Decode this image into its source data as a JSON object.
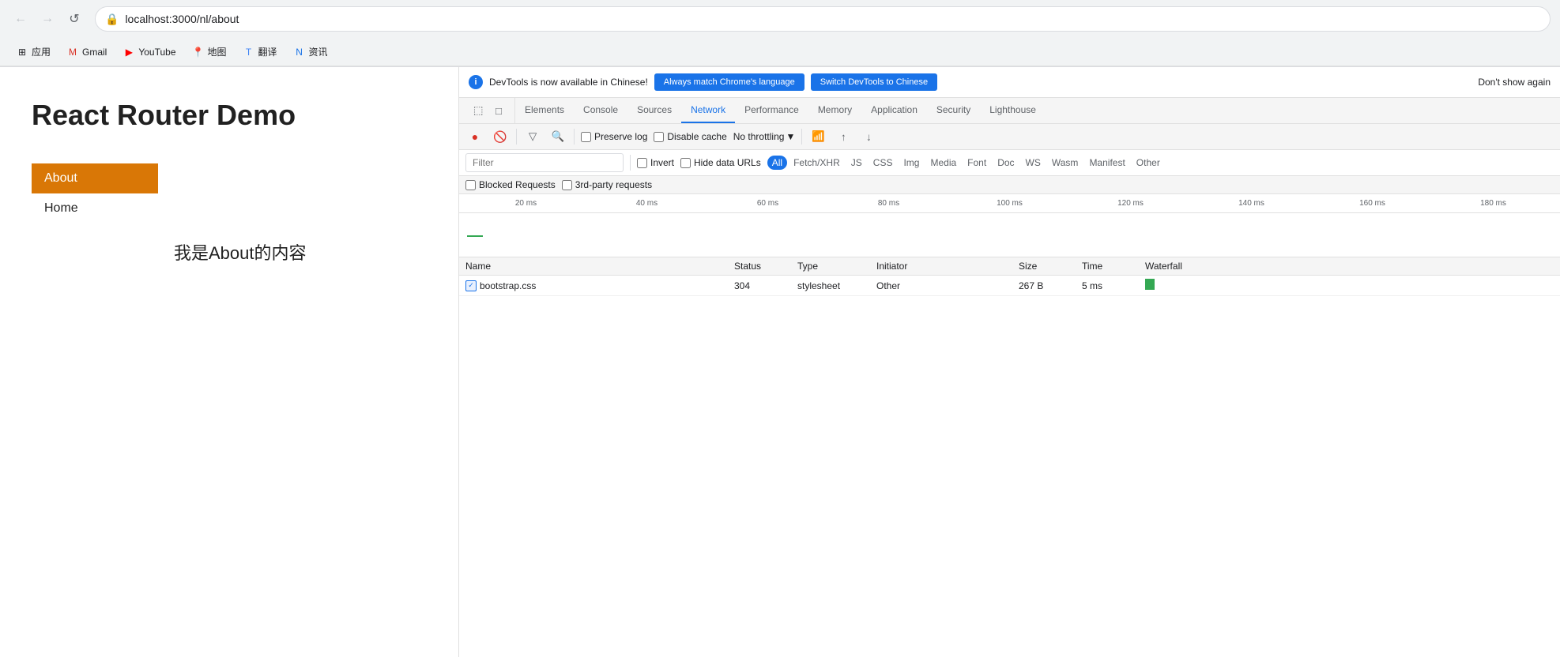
{
  "browser": {
    "back_btn": "←",
    "forward_btn": "→",
    "reload_btn": "↺",
    "url": "localhost:3000/nl/about",
    "bookmarks": [
      {
        "label": "应用",
        "icon": "grid"
      },
      {
        "label": "Gmail",
        "icon": "gmail"
      },
      {
        "label": "YouTube",
        "icon": "youtube"
      },
      {
        "label": "地图",
        "icon": "maps"
      },
      {
        "label": "翻译",
        "icon": "translate"
      },
      {
        "label": "资讯",
        "icon": "news"
      }
    ]
  },
  "page": {
    "title": "React Router Demo",
    "nav_items": [
      {
        "label": "About",
        "active": true
      },
      {
        "label": "Home",
        "active": false
      }
    ],
    "body_text": "我是About的内容"
  },
  "devtools": {
    "notification": {
      "info_icon": "i",
      "text": "DevTools is now available in Chinese!",
      "btn_primary": "Always match Chrome's language",
      "btn_secondary": "Switch DevTools to Chinese",
      "dismiss": "Don't show again"
    },
    "tabs": [
      {
        "label": "Elements",
        "active": false
      },
      {
        "label": "Console",
        "active": false
      },
      {
        "label": "Sources",
        "active": false
      },
      {
        "label": "Network",
        "active": true
      },
      {
        "label": "Performance",
        "active": false
      },
      {
        "label": "Memory",
        "active": false
      },
      {
        "label": "Application",
        "active": false
      },
      {
        "label": "Security",
        "active": false
      },
      {
        "label": "Lighthouse",
        "active": false
      }
    ],
    "toolbar": {
      "record_label": "●",
      "clear_label": "🚫",
      "filter_label": "▽",
      "search_label": "🔍",
      "preserve_log_label": "Preserve log",
      "disable_cache_label": "Disable cache",
      "throttle_label": "No throttling",
      "throttle_arrow": "▼",
      "wifi_icon": "wifi",
      "upload_icon": "↑",
      "download_icon": "↓"
    },
    "filter_bar": {
      "placeholder": "Filter",
      "invert_label": "Invert",
      "hide_data_urls_label": "Hide data URLs",
      "types": [
        "All",
        "Fetch/XHR",
        "JS",
        "CSS",
        "Img",
        "Media",
        "Font",
        "Doc",
        "WS",
        "Wasm",
        "Manifest",
        "Other"
      ]
    },
    "blocked_requests_label": "Blocked Requests",
    "third_party_label": "3rd-party requests",
    "timeline": {
      "ticks": [
        "20 ms",
        "40 ms",
        "60 ms",
        "80 ms",
        "100 ms",
        "120 ms",
        "140 ms",
        "160 ms",
        "180 ms"
      ]
    },
    "table": {
      "columns": [
        "Name",
        "Status",
        "Type",
        "Initiator",
        "Size",
        "Time",
        "Waterfall"
      ],
      "rows": [
        {
          "name": "bootstrap.css",
          "status": "304",
          "type": "stylesheet",
          "initiator": "Other",
          "size": "267 B",
          "time": "5 ms"
        }
      ]
    }
  }
}
